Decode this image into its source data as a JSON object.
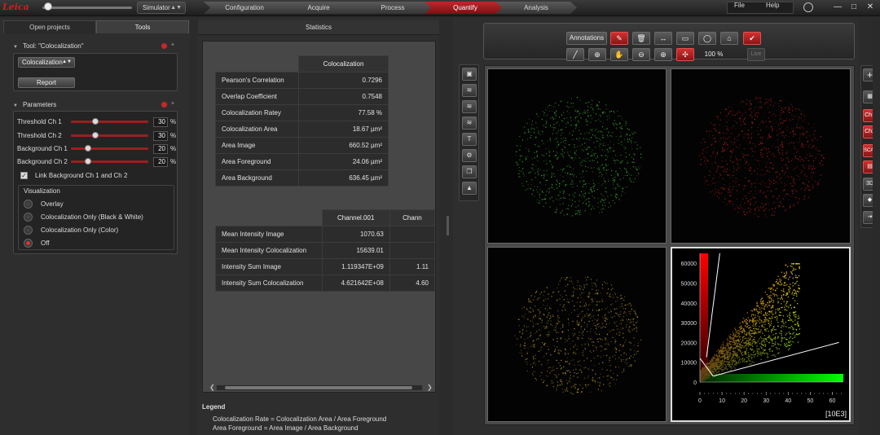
{
  "app": {
    "logo_text": "Leica",
    "mode": "Simulator",
    "workflow": [
      "Configuration",
      "Acquire",
      "Process",
      "Quantify",
      "Analysis"
    ],
    "active_step": "Quantify",
    "menu": [
      "File",
      "Help"
    ]
  },
  "left_panel": {
    "tabs": [
      "Open projects",
      "Tools"
    ],
    "tool_header": "Tool: \"Colocalization\"",
    "tool_select": "Colocalization",
    "report_button": "Report",
    "parameters_header": "Parameters",
    "params": [
      {
        "label": "Threshold Ch 1",
        "value": "30",
        "unit": "%",
        "level": 0.3
      },
      {
        "label": "Threshold Ch 2",
        "value": "30",
        "unit": "%",
        "level": 0.3
      },
      {
        "label": "Background Ch 1",
        "value": "20",
        "unit": "%",
        "level": 0.2
      },
      {
        "label": "Background Ch 2",
        "value": "20",
        "unit": "%",
        "level": 0.2
      }
    ],
    "link_label": "Link Background Ch 1 and Ch 2",
    "link_checked": true,
    "visualization_header": "Visualization",
    "visualization_options": [
      "Overlay",
      "Colocalization Only (Black & White)",
      "Colocalization Only (Color)",
      "Off"
    ],
    "visualization_selected": "Off"
  },
  "statistics": {
    "title": "Statistics",
    "coloc_header": "Colocalization",
    "coloc_rows": [
      {
        "label": "Pearson's Correlation",
        "value": "0.7296"
      },
      {
        "label": "Overlap Coefficient",
        "value": "0.7548"
      },
      {
        "label": "Colocalization Ratey",
        "value": "77.58  %"
      },
      {
        "label": "Colocalization Area",
        "value": "18.67  µm²"
      },
      {
        "label": "Area Image",
        "value": "660.52  µm²"
      },
      {
        "label": "Area Foreground",
        "value": "24.06  µm²"
      },
      {
        "label": "Area Background",
        "value": "636.45  µm²"
      }
    ],
    "channel_headers": [
      "Channel.001",
      "Chann"
    ],
    "channel_rows": [
      {
        "label": "Mean Intensity Image",
        "v1": "1070.63",
        "v2": ""
      },
      {
        "label": "Mean Intensity Colocalization",
        "v1": "15639.01",
        "v2": ""
      },
      {
        "label": "Intensity Sum Image",
        "v1": "1.119347E+09",
        "v2": "1.11"
      },
      {
        "label": "Intensity Sum Colocalization",
        "v1": "4.621642E+08",
        "v2": "4.60"
      }
    ],
    "legend_title": "Legend",
    "legend_lines": [
      "Colocalization Rate  =  Colocalization Area / Area Foreground",
      "Area Foreground  =  Area Image / Area Background"
    ]
  },
  "image_toolbar": {
    "annotations_label": "Annotations",
    "zoom": "100 %",
    "live_label": "Live"
  },
  "right_toolbar": [
    "Ch1",
    "Ch2",
    "SCAT",
    "3D"
  ],
  "chart_data": {
    "type": "scatter",
    "title": "",
    "xlabel": "",
    "ylabel": "",
    "xlim": [
      0,
      65
    ],
    "ylim": [
      0,
      65000
    ],
    "x_ticks": [
      "0",
      "10",
      "20",
      "30",
      "40",
      "50",
      "60"
    ],
    "y_ticks": [
      "0",
      "10000",
      "20000",
      "30000",
      "40000",
      "50000",
      "60000"
    ],
    "unit_label": "[10E3]",
    "threshold_lines": true
  }
}
